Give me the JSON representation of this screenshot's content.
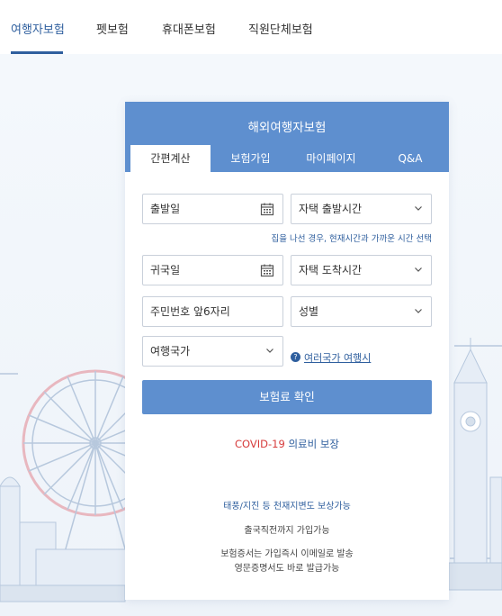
{
  "topnav": {
    "tabs": [
      "여행자보험",
      "펫보험",
      "휴대폰보험",
      "직원단체보험"
    ]
  },
  "card": {
    "title": "해외여행자보험",
    "tabs": [
      "간편계산",
      "보험가입",
      "마이페이지",
      "Q&A"
    ]
  },
  "form": {
    "departure_date": "출발일",
    "departure_time": "자택 출발시간",
    "departure_hint": "집을 나선 경우, 현재시간과 가까운 시간 선택",
    "return_date": "귀국일",
    "arrival_time": "자택 도착시간",
    "ssn": "주민번호 앞6자리",
    "gender": "성별",
    "country": "여행국가",
    "multi_country_link": "여러국가 여행시",
    "submit": "보험료 확인"
  },
  "promo": {
    "covid_red": "COVID-19",
    "covid_blue": "의료비 보장",
    "note1": "태풍/지진 등 천재지변도 보상가능",
    "note2": "출국직전까지 가입가능",
    "note3": "보험증서는 가입즉시 이메일로 발송",
    "note4": "영문증명서도 바로 발급가능"
  },
  "colors": {
    "accent": "#5e8fcf",
    "link": "#2f5f9e",
    "covid": "#d63b3b"
  },
  "icons": [
    "calendar-icon",
    "chevron-down-icon",
    "question-icon"
  ]
}
